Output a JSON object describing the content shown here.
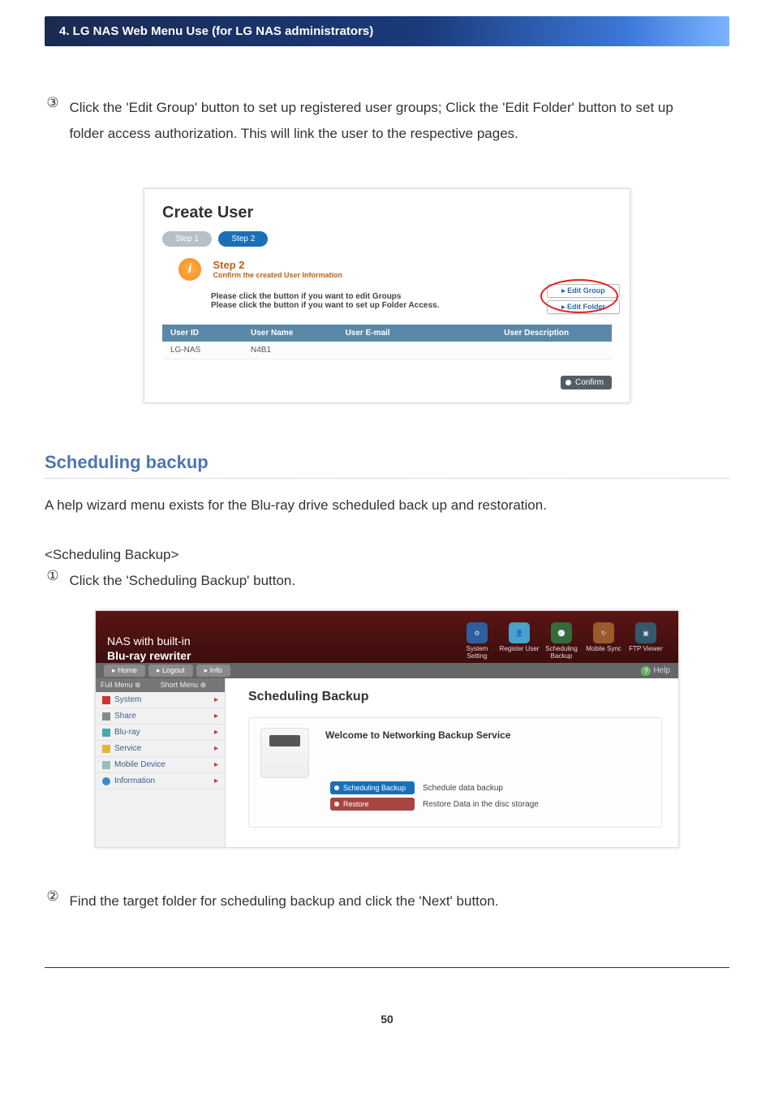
{
  "header": {
    "title": "4. LG NAS Web Menu Use (for LG NAS administrators)"
  },
  "step3": {
    "num": "③",
    "text": "Click the 'Edit Group' button to set up registered user groups; Click the 'Edit Folder' button to set up folder access authorization. This will link the user to the respective pages."
  },
  "createUser": {
    "title": "Create User",
    "pill1": "Step 1",
    "pill2": "Step 2",
    "step2Head": "Step 2",
    "step2Sub": "Confirm the created User Information",
    "line1": "Please click the button if you want to edit Groups",
    "line2": "Please click the button if you want to set up Folder Access.",
    "editGroup": "▸ Edit Group",
    "editFolder": "▸ Edit Folder",
    "cols": {
      "id": "User ID",
      "name": "User Name",
      "mail": "User E-mail",
      "desc": "User Description"
    },
    "row": {
      "id": "LG-NAS",
      "name": "N4B1",
      "mail": "",
      "desc": ""
    },
    "confirm": "Confirm"
  },
  "section": {
    "title": "Scheduling backup",
    "intro": "A help wizard menu exists for the Blu-ray drive scheduled back up and restoration.",
    "subhead": "<Scheduling Backup>"
  },
  "step1b": {
    "num": "①",
    "text": "Click the 'Scheduling Backup' button."
  },
  "shot2": {
    "brand1": "NAS with built-in",
    "brand2": "Blu-ray rewriter",
    "icons": {
      "sys": "System Setting",
      "reg": "Register User",
      "sch": "Scheduling Backup",
      "mob": "Mobile Sync",
      "ftp": "FTP Viewer"
    },
    "tabs": {
      "home": "▸ Home",
      "logout": "▸ Logout",
      "info": "▸ Info"
    },
    "help": "Help",
    "sideHead": {
      "full": "Full Menu ⊕",
      "short": "Short Menu ⊕"
    },
    "side": {
      "system": "System",
      "share": "Share",
      "bluray": "Blu-ray",
      "service": "Service",
      "mobile": "Mobile Device",
      "info": "Information"
    },
    "mainTitle": "Scheduling Backup",
    "welcome": "Welcome to Networking Backup Service",
    "btnSched": "Scheduling Backup",
    "btnSchedDesc": "Schedule data backup",
    "btnRestore": "Restore",
    "btnRestoreDesc": "Restore Data in the disc storage"
  },
  "step2b": {
    "num": "②",
    "text": "Find the target folder for scheduling backup and click the 'Next' button."
  },
  "pageNumber": "50"
}
